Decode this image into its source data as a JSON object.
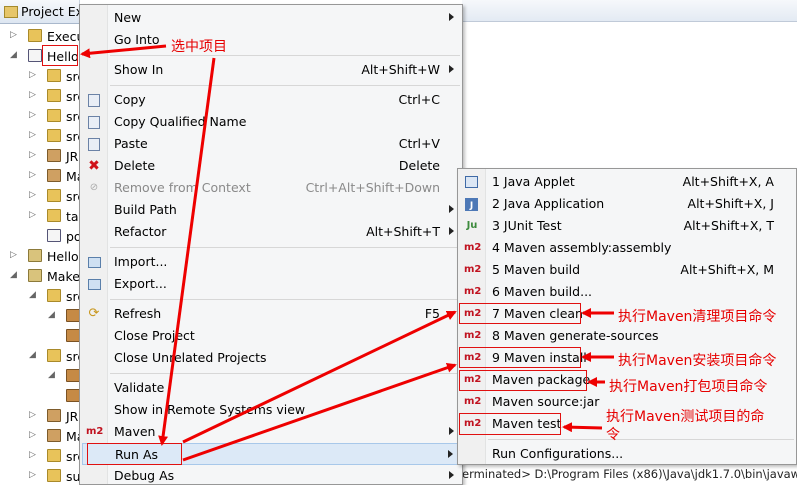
{
  "explorer": {
    "tab_title": "Project Ex",
    "rows": [
      {
        "label": "Execu",
        "icon": "folder-icon",
        "indent": 0,
        "arrow": "▷"
      },
      {
        "label": "Hello",
        "icon": "maven-project-icon",
        "indent": 0,
        "arrow": "◢"
      },
      {
        "label": "src",
        "icon": "package-folder-icon",
        "indent": 1,
        "arrow": "▷"
      },
      {
        "label": "src",
        "icon": "package-folder-icon",
        "indent": 1,
        "arrow": "▷"
      },
      {
        "label": "src",
        "icon": "package-folder-icon",
        "indent": 1,
        "arrow": "▷"
      },
      {
        "label": "src",
        "icon": "package-folder-icon",
        "indent": 1,
        "arrow": "▷"
      },
      {
        "label": "JR",
        "icon": "jar-library-icon",
        "indent": 1,
        "arrow": "▷"
      },
      {
        "label": "Ma",
        "icon": "jar-library-icon",
        "indent": 1,
        "arrow": "▷"
      },
      {
        "label": "src",
        "icon": "folder-icon",
        "indent": 1,
        "arrow": "▷"
      },
      {
        "label": "tar",
        "icon": "folder-icon",
        "indent": 1,
        "arrow": "▷"
      },
      {
        "label": "po",
        "icon": "pom-file-icon",
        "indent": 1,
        "arrow": ""
      },
      {
        "label": "HelloF",
        "icon": "project-icon",
        "indent": 0,
        "arrow": "▷"
      },
      {
        "label": "Make",
        "icon": "project-icon",
        "indent": 0,
        "arrow": "◢"
      },
      {
        "label": "src",
        "icon": "package-folder-icon",
        "indent": 1,
        "arrow": "◢"
      },
      {
        "label": "",
        "icon": "package-icon",
        "indent": 2,
        "arrow": "◢"
      },
      {
        "label": "",
        "icon": "package-icon",
        "indent": 2,
        "arrow": ""
      },
      {
        "label": "src",
        "icon": "package-folder-icon",
        "indent": 1,
        "arrow": "◢"
      },
      {
        "label": "",
        "icon": "package-icon",
        "indent": 2,
        "arrow": "◢"
      },
      {
        "label": "",
        "icon": "package-icon",
        "indent": 2,
        "arrow": ""
      },
      {
        "label": "JR",
        "icon": "jar-library-icon",
        "indent": 1,
        "arrow": "▷"
      },
      {
        "label": "Ma",
        "icon": "jar-library-icon",
        "indent": 1,
        "arrow": "▷"
      },
      {
        "label": "src",
        "icon": "folder-icon",
        "indent": 1,
        "arrow": "▷"
      },
      {
        "label": "su",
        "icon": "folder-icon",
        "indent": 1,
        "arrow": "▷"
      }
    ]
  },
  "context_menu": {
    "items": [
      {
        "label": "New",
        "shortcut": "",
        "submenu": true,
        "icon": "",
        "disabled": false
      },
      {
        "label": "Go Into",
        "shortcut": "",
        "submenu": false,
        "icon": "",
        "disabled": false
      },
      {
        "sep": true
      },
      {
        "label": "Show In",
        "shortcut": "Alt+Shift+W",
        "submenu": true,
        "icon": "",
        "disabled": false
      },
      {
        "sep": true
      },
      {
        "label": "Copy",
        "shortcut": "Ctrl+C",
        "submenu": false,
        "icon": "copy-icon",
        "disabled": false
      },
      {
        "label": "Copy Qualified Name",
        "shortcut": "",
        "submenu": false,
        "icon": "copy-icon",
        "disabled": false
      },
      {
        "label": "Paste",
        "shortcut": "Ctrl+V",
        "submenu": false,
        "icon": "paste-icon",
        "disabled": false
      },
      {
        "label": "Delete",
        "shortcut": "Delete",
        "submenu": false,
        "icon": "delete-icon",
        "disabled": false
      },
      {
        "label": "Remove from Context",
        "shortcut": "Ctrl+Alt+Shift+Down",
        "submenu": false,
        "icon": "remove-context-icon",
        "disabled": true
      },
      {
        "label": "Build Path",
        "shortcut": "",
        "submenu": true,
        "icon": "",
        "disabled": false
      },
      {
        "label": "Refactor",
        "shortcut": "Alt+Shift+T",
        "submenu": true,
        "icon": "",
        "disabled": false
      },
      {
        "sep": true
      },
      {
        "label": "Import...",
        "shortcut": "",
        "submenu": false,
        "icon": "import-icon",
        "disabled": false
      },
      {
        "label": "Export...",
        "shortcut": "",
        "submenu": false,
        "icon": "export-icon",
        "disabled": false
      },
      {
        "sep": true
      },
      {
        "label": "Refresh",
        "shortcut": "F5",
        "submenu": false,
        "icon": "refresh-icon",
        "disabled": false
      },
      {
        "label": "Close Project",
        "shortcut": "",
        "submenu": false,
        "icon": "",
        "disabled": false
      },
      {
        "label": "Close Unrelated Projects",
        "shortcut": "",
        "submenu": false,
        "icon": "",
        "disabled": false
      },
      {
        "sep": true
      },
      {
        "label": "Validate",
        "shortcut": "",
        "submenu": false,
        "icon": "",
        "disabled": false
      },
      {
        "label": "Show in Remote Systems view",
        "shortcut": "",
        "submenu": false,
        "icon": "",
        "disabled": false
      },
      {
        "label": "Maven",
        "shortcut": "",
        "submenu": true,
        "icon": "m2-icon",
        "disabled": false
      },
      {
        "label": "Run As",
        "shortcut": "",
        "submenu": true,
        "icon": "",
        "disabled": false,
        "highlight": true
      },
      {
        "label": "Debug As",
        "shortcut": "",
        "submenu": true,
        "icon": "",
        "disabled": false
      }
    ]
  },
  "run_as_menu": {
    "items": [
      {
        "label": "1 Java Applet",
        "shortcut": "Alt+Shift+X, A",
        "icon": "java-applet-icon"
      },
      {
        "label": "2 Java Application",
        "shortcut": "Alt+Shift+X, J",
        "icon": "java-application-icon"
      },
      {
        "label": "3 JUnit Test",
        "shortcut": "Alt+Shift+X, T",
        "icon": "junit-icon"
      },
      {
        "label": "4 Maven assembly:assembly",
        "shortcut": "",
        "icon": "m2-icon"
      },
      {
        "label": "5 Maven build",
        "shortcut": "Alt+Shift+X, M",
        "icon": "m2-icon"
      },
      {
        "label": "6 Maven build...",
        "shortcut": "",
        "icon": "m2-icon"
      },
      {
        "label": "7 Maven clean",
        "shortcut": "",
        "icon": "m2-icon",
        "boxed": true
      },
      {
        "label": "8 Maven generate-sources",
        "shortcut": "",
        "icon": "m2-icon"
      },
      {
        "label": "9 Maven install",
        "shortcut": "",
        "icon": "m2-icon",
        "boxed": true
      },
      {
        "label": "Maven package",
        "shortcut": "",
        "icon": "m2-icon",
        "boxed": true
      },
      {
        "label": "Maven source:jar",
        "shortcut": "",
        "icon": "m2-icon"
      },
      {
        "label": "Maven test",
        "shortcut": "",
        "icon": "m2-icon",
        "boxed": true
      },
      {
        "sep": true
      },
      {
        "label": "Run Configurations...",
        "shortcut": "",
        "icon": ""
      }
    ]
  },
  "m2_text": "m2",
  "annotations": {
    "select_project": "选中项目",
    "clean": "执行Maven清理项目命令",
    "install": "执行Maven安装项目命令",
    "package": "执行Maven打包项目命令",
    "test_line1": "执行Maven测试项目的命",
    "test_line2": "令"
  },
  "console_text": "erminated> D:\\Program Files (x86)\\Java\\jdk1.7.0\\bin\\javaw",
  "colors": {
    "annotation": "#e60000",
    "highlight_bg": "#dce9f7",
    "menu_bg": "#f5f6f7",
    "m2": "#c0121f"
  }
}
